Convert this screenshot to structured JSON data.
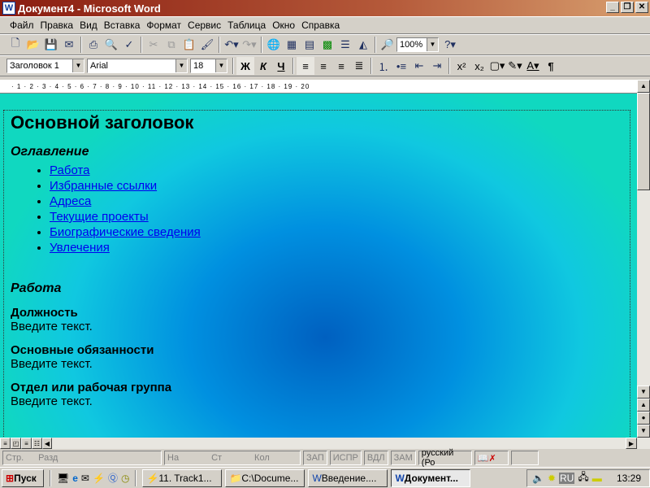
{
  "window": {
    "title": "Документ4 - Microsoft Word",
    "app_icon": "W"
  },
  "menu": [
    "Файл",
    "Правка",
    "Вид",
    "Вставка",
    "Формат",
    "Сервис",
    "Таблица",
    "Окно",
    "Справка"
  ],
  "toolbar": {
    "zoom": "100%",
    "style": "Заголовок 1",
    "font": "Arial",
    "size": "18",
    "bold": "Ж",
    "italic": "К",
    "underline": "Ч",
    "pilcrow": "¶"
  },
  "ruler": "· 1 · 2 · 3 · 4 · 5 · 6 · 7 · 8 · 9 · 10 · 11 · 12 · 13 · 14 · 15 · 16 · 17 · 18 · 19 · 20",
  "document": {
    "title": "Основной заголовок",
    "toc_heading": "Оглавление",
    "toc": [
      "Работа",
      "Избранные ссылки",
      "Адреса",
      "Текущие проекты",
      "Биографические сведения",
      "Увлечения"
    ],
    "section": "Работа",
    "fields": [
      {
        "label": "Должность",
        "text": "Введите текст."
      },
      {
        "label": "Основные обязанности",
        "text": "Введите текст."
      },
      {
        "label": "Отдел или рабочая группа",
        "text": "Введите текст."
      }
    ]
  },
  "status": {
    "page": "Стр.",
    "section": "Разд",
    "at": "На",
    "line": "Ст",
    "col": "Кол",
    "rec": "ЗАП",
    "trk": "ИСПР",
    "ext": "ВДЛ",
    "ovr": "ЗАМ",
    "lang": "русский (Ро"
  },
  "taskbar": {
    "start": "Пуск",
    "tasks": [
      "11. Track1...",
      "C:\\Docume...",
      "Введение....",
      "Документ..."
    ],
    "lang": "RU",
    "clock": "13:29"
  }
}
